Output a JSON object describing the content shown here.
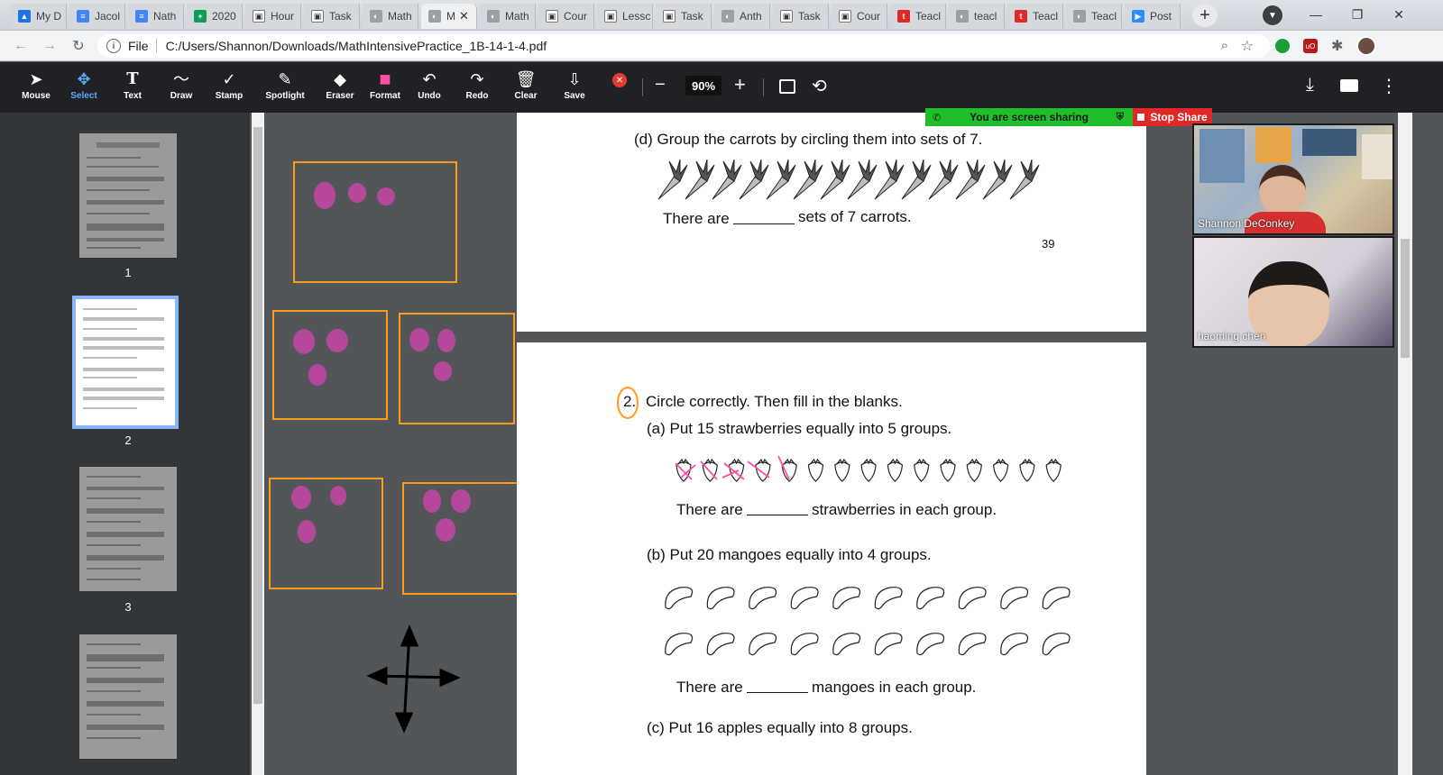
{
  "browser": {
    "tabs": [
      {
        "label": "My D",
        "icon": "drive-icon",
        "color": "#1a73e8"
      },
      {
        "label": "Jacol",
        "icon": "docs-icon",
        "color": "#4285f4"
      },
      {
        "label": "Nath",
        "icon": "docs-icon",
        "color": "#4285f4"
      },
      {
        "label": "2020",
        "icon": "sheets-icon",
        "color": "#0f9d58"
      },
      {
        "label": "Hour",
        "icon": "classroom-icon",
        "color": "#ffffff"
      },
      {
        "label": "Task",
        "icon": "classroom-icon",
        "color": "#ffffff"
      },
      {
        "label": "Math",
        "icon": "globe-icon",
        "color": "#9aa0a6"
      },
      {
        "label": "M",
        "icon": "globe-icon",
        "color": "#9aa0a6"
      },
      {
        "label": "Math",
        "icon": "globe-icon",
        "color": "#9aa0a6"
      },
      {
        "label": "Cour",
        "icon": "classroom-icon",
        "color": "#ffffff"
      },
      {
        "label": "Lessc",
        "icon": "classroom-icon",
        "color": "#ffffff"
      },
      {
        "label": "Task",
        "icon": "classroom-icon",
        "color": "#ffffff"
      },
      {
        "label": "Anth",
        "icon": "globe-icon",
        "color": "#9aa0a6"
      },
      {
        "label": "Task",
        "icon": "classroom-icon",
        "color": "#ffffff"
      },
      {
        "label": "Cour",
        "icon": "classroom-icon",
        "color": "#ffffff"
      },
      {
        "label": "Teacl",
        "icon": "tpt-icon",
        "color": "#e02828"
      },
      {
        "label": "teacl",
        "icon": "globe-icon",
        "color": "#9aa0a6"
      },
      {
        "label": "Teacl",
        "icon": "tpt-icon",
        "color": "#e02828"
      },
      {
        "label": "Teacl",
        "icon": "globe-icon",
        "color": "#9aa0a6"
      },
      {
        "label": "Post",
        "icon": "zoom-icon",
        "color": "#2d8cff"
      }
    ],
    "active_tab_index": 7,
    "address": {
      "scheme": "File",
      "url": "C:/Users/Shannon/Downloads/MathIntensivePractice_1B-14-1-4.pdf"
    }
  },
  "toolbar": {
    "tools": [
      {
        "label": "Mouse",
        "icon": "cursor-arrow-icon",
        "glyph": "➤"
      },
      {
        "label": "Select",
        "icon": "move-arrows-icon",
        "glyph": "✥"
      },
      {
        "label": "Text",
        "icon": "text-t-icon",
        "glyph": "T"
      },
      {
        "label": "Draw",
        "icon": "squiggle-icon",
        "glyph": "〜"
      },
      {
        "label": "Stamp",
        "icon": "checkmark-icon",
        "glyph": "✓"
      },
      {
        "label": "Spotlight",
        "icon": "magic-wand-icon",
        "glyph": "✎"
      },
      {
        "label": "Eraser",
        "icon": "eraser-icon",
        "glyph": "◆"
      },
      {
        "label": "Format",
        "icon": "color-swatch-icon",
        "glyph": "■"
      },
      {
        "label": "Undo",
        "icon": "undo-icon",
        "glyph": "↶"
      },
      {
        "label": "Redo",
        "icon": "redo-icon",
        "glyph": "↷"
      },
      {
        "label": "Clear",
        "icon": "trash-icon",
        "glyph": "🗑"
      },
      {
        "label": "Save",
        "icon": "save-download-icon",
        "glyph": "⇩"
      }
    ],
    "selected_tool": "Select",
    "zoom": "90%",
    "format_color": "#ff4fa3"
  },
  "thumbnails": {
    "pages": [
      {
        "number": "1"
      },
      {
        "number": "2"
      },
      {
        "number": "3"
      }
    ],
    "current": "2"
  },
  "pdf": {
    "page1": {
      "question_d": "(d)  Group the carrots by circling them into sets of 7.",
      "answer_d_pre": "There are",
      "answer_d_post": "sets of 7 carrots.",
      "page_number": "39"
    },
    "page2": {
      "q_number": "2.",
      "q_instruction": "Circle correctly. Then fill in the blanks.",
      "a_prompt": "(a)  Put 15 strawberries equally into 5 groups.",
      "a_answer_pre": "There are",
      "a_answer_post": "strawberries in each group.",
      "b_prompt": "(b)  Put 20 mangoes equally into 4 groups.",
      "b_answer_pre": "There are",
      "b_answer_post": "mangoes in each group.",
      "c_prompt": "(c)  Put 16 apples equally into 8 groups."
    },
    "annotation_color": "#b5489b",
    "box_color": "#ff9a1a"
  },
  "screenshare": {
    "status": "You are screen sharing",
    "stop_label": "Stop Share",
    "participants": [
      {
        "name": "Shannon DeConkey"
      },
      {
        "name": "haoming chen"
      }
    ]
  }
}
